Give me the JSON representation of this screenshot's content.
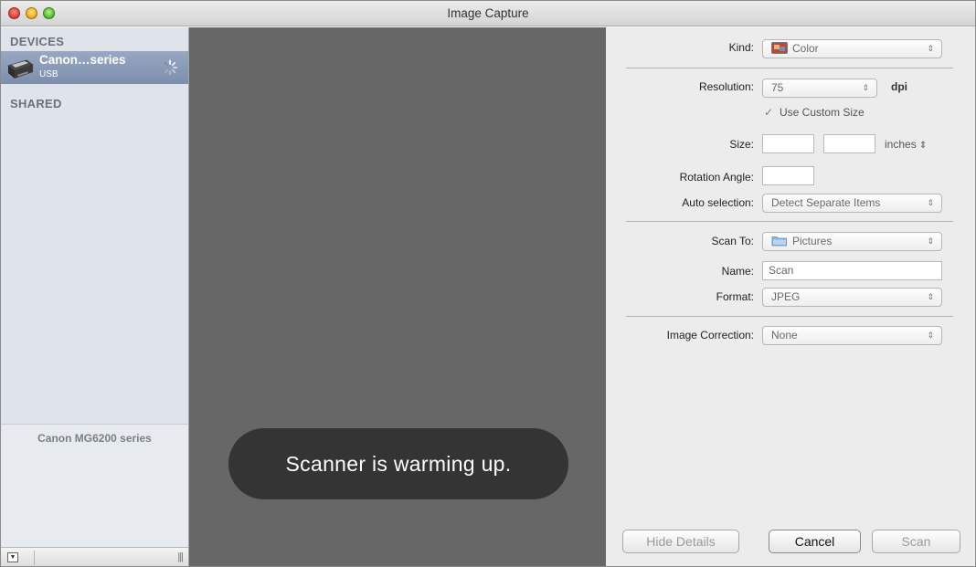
{
  "window": {
    "title": "Image Capture"
  },
  "sidebar": {
    "devices_header": "DEVICES",
    "device": {
      "name": "Canon…series",
      "connection": "USB"
    },
    "shared_header": "SHARED",
    "selected_device_label": "Canon MG6200 series"
  },
  "scan_area": {
    "status_message": "Scanner is warming up."
  },
  "details": {
    "kind": {
      "label": "Kind:",
      "value": "Color",
      "icon": "color-swatch-icon"
    },
    "resolution": {
      "label": "Resolution:",
      "value": "75",
      "unit": "dpi"
    },
    "use_custom_size": {
      "label": "Use Custom Size",
      "checked": true
    },
    "size": {
      "label": "Size:",
      "width": "",
      "height": "",
      "unit": "inches"
    },
    "rotation_angle": {
      "label": "Rotation Angle:",
      "value": ""
    },
    "auto_selection": {
      "label": "Auto selection:",
      "value": "Detect Separate Items"
    },
    "scan_to": {
      "label": "Scan To:",
      "value": "Pictures",
      "icon": "folder-icon"
    },
    "name": {
      "label": "Name:",
      "value": "Scan"
    },
    "format": {
      "label": "Format:",
      "value": "JPEG"
    },
    "image_correction": {
      "label": "Image Correction:",
      "value": "None"
    }
  },
  "buttons": {
    "hide_details": "Hide Details",
    "cancel": "Cancel",
    "scan": "Scan"
  },
  "colors": {
    "sidebar_bg": "#dfe4ea",
    "selection": "#8a9bb8",
    "scan_bg": "#676767",
    "toast_bg": "#343434",
    "panel_bg": "#ececec"
  }
}
